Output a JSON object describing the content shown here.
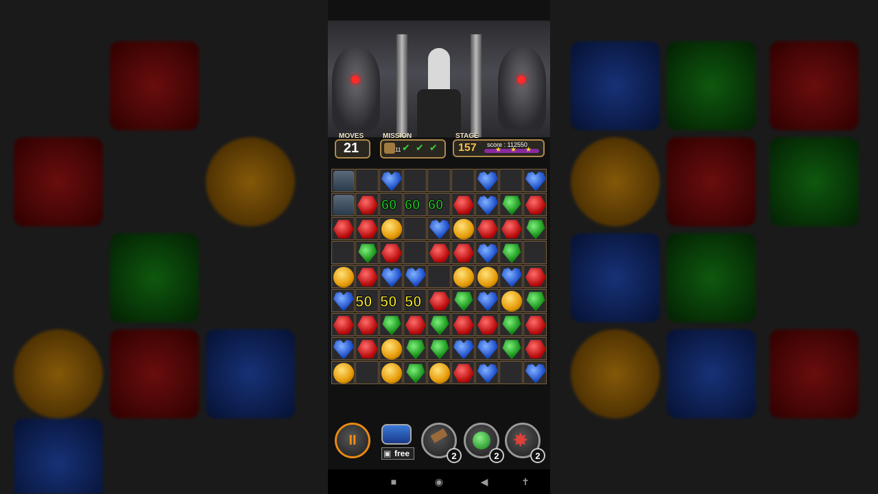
{
  "game": {
    "hud": {
      "moves_label": "MOVES",
      "moves_value": "21",
      "mission_label": "MISSION",
      "mission_count": "11",
      "stage_label": "STAGE",
      "stage_value": "157",
      "score_label": "score : 112550",
      "stars": 3
    },
    "board": {
      "rows": [
        [
          "tile-icon",
          "empty",
          "blue",
          "empty",
          "empty",
          "empty",
          "blue",
          "empty",
          "blue"
        ],
        [
          "tile-icon",
          "red",
          "empty",
          "empty",
          "empty",
          "red",
          "blue",
          "green",
          "red"
        ],
        [
          "red",
          "red",
          "orange",
          "empty",
          "blue",
          "orange",
          "red",
          "red",
          "green"
        ],
        [
          "empty",
          "green",
          "red",
          "empty",
          "red",
          "red",
          "blue",
          "green",
          "empty"
        ],
        [
          "orange",
          "red",
          "blue",
          "blue",
          "empty",
          "orange",
          "orange",
          "blue",
          "red"
        ],
        [
          "blue",
          "empty",
          "empty",
          "empty",
          "red",
          "green",
          "blue",
          "orange",
          "green"
        ],
        [
          "red",
          "red",
          "green",
          "red",
          "green",
          "red",
          "red",
          "green",
          "red"
        ],
        [
          "blue",
          "red",
          "orange",
          "green",
          "green",
          "blue",
          "blue",
          "green",
          "red"
        ],
        [
          "orange",
          "empty",
          "orange",
          "green",
          "orange",
          "red",
          "blue",
          "empty",
          "blue"
        ]
      ],
      "popups_top": [
        "60",
        "60",
        "60"
      ],
      "popups_mid": [
        "50",
        "50",
        "50"
      ]
    },
    "controls": {
      "pause_label": "II",
      "free_label": "free",
      "hammer_count": "2",
      "bomb_count": "2",
      "star_count": "2"
    },
    "colors": {
      "hud_border": "#b08a4a",
      "score_60": "#22d022",
      "score_50": "#f2e62a",
      "pause_ring": "#e98a10"
    }
  },
  "navbar": {
    "square_icon": "■",
    "circle_icon": "◉",
    "back_icon": "◀",
    "accessibility_icon": "✝"
  }
}
